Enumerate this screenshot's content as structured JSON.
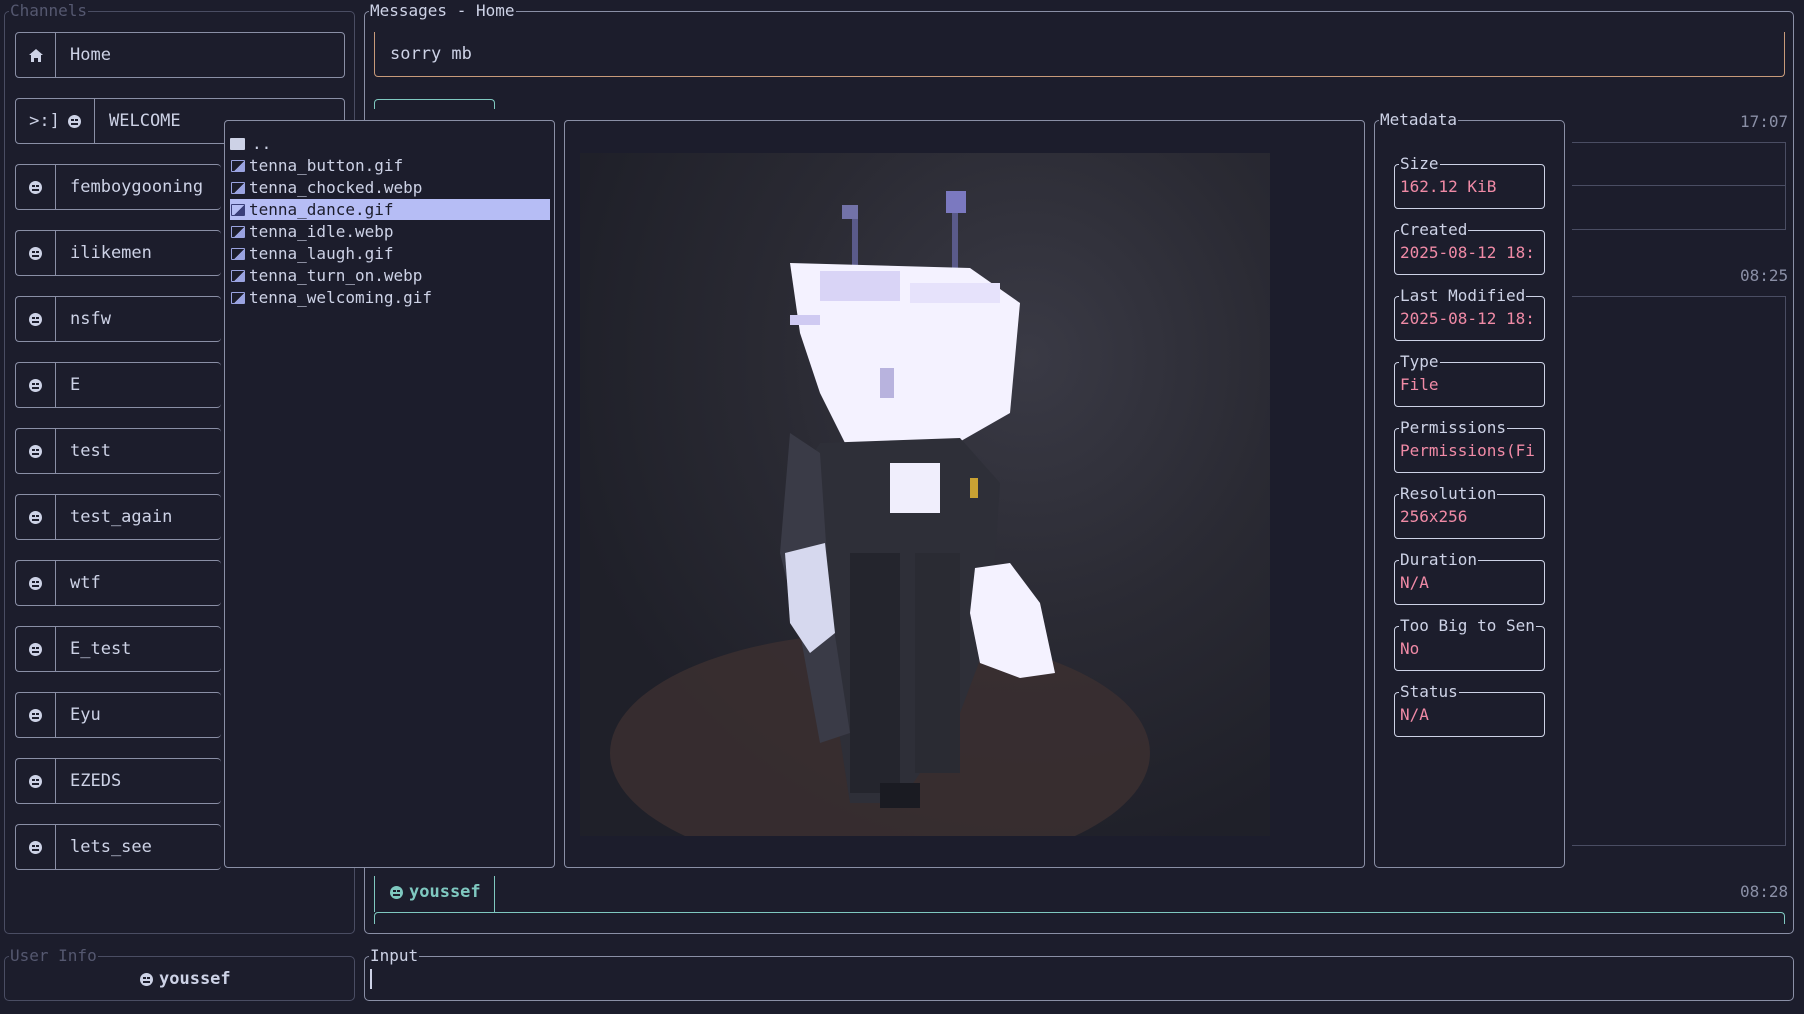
{
  "channels_panel": {
    "title": "Channels",
    "items": [
      {
        "icon": "home-icon",
        "label": "Home"
      },
      {
        "prefix": ">:]",
        "icon": "face-icon",
        "label": "WELCOME"
      },
      {
        "icon": "face-icon",
        "label": "femboygooning"
      },
      {
        "icon": "face-icon",
        "label": "ilikemen"
      },
      {
        "icon": "face-icon",
        "label": "nsfw"
      },
      {
        "icon": "face-icon",
        "label": "E"
      },
      {
        "icon": "face-icon",
        "label": "test"
      },
      {
        "icon": "face-icon",
        "label": "test_again"
      },
      {
        "icon": "face-icon",
        "label": "wtf"
      },
      {
        "icon": "face-icon",
        "label": "E_test"
      },
      {
        "icon": "face-icon",
        "label": "Eyu"
      },
      {
        "icon": "face-icon",
        "label": "EZEDS"
      },
      {
        "icon": "face-icon",
        "label": "lets_see"
      }
    ]
  },
  "messages_panel": {
    "title": "Messages - Home",
    "top_message": "sorry mb",
    "timestamps": [
      "17:07",
      "08:25",
      "08:28"
    ],
    "last_author": "youssef"
  },
  "file_browser": {
    "parent": "..",
    "files": [
      {
        "name": "tenna_button.gif",
        "selected": false
      },
      {
        "name": "tenna_chocked.webp",
        "selected": false
      },
      {
        "name": "tenna_dance.gif",
        "selected": true
      },
      {
        "name": "tenna_idle.webp",
        "selected": false
      },
      {
        "name": "tenna_laugh.gif",
        "selected": false
      },
      {
        "name": "tenna_turn_on.webp",
        "selected": false
      },
      {
        "name": "tenna_welcoming.gif",
        "selected": false
      }
    ]
  },
  "metadata": {
    "title": "Metadata",
    "fields": [
      {
        "label": "Size",
        "value": "162.12 KiB"
      },
      {
        "label": "Created",
        "value": "2025-08-12 18:"
      },
      {
        "label": "Last Modified",
        "value": "2025-08-12 18:"
      },
      {
        "label": "Type",
        "value": "File"
      },
      {
        "label": "Permissions",
        "value": "Permissions(Fi"
      },
      {
        "label": "Resolution",
        "value": "256x256"
      },
      {
        "label": "Duration",
        "value": "N/A"
      },
      {
        "label": "Too Big to Sen",
        "value": "No"
      },
      {
        "label": "Status",
        "value": "N/A"
      }
    ]
  },
  "user_info": {
    "title": "User Info",
    "username": "youssef"
  },
  "input": {
    "title": "Input",
    "value": ""
  },
  "colors": {
    "background": "#1c1d2c",
    "accent_value": "#f08aa6",
    "selection": "#b6bdf5"
  }
}
